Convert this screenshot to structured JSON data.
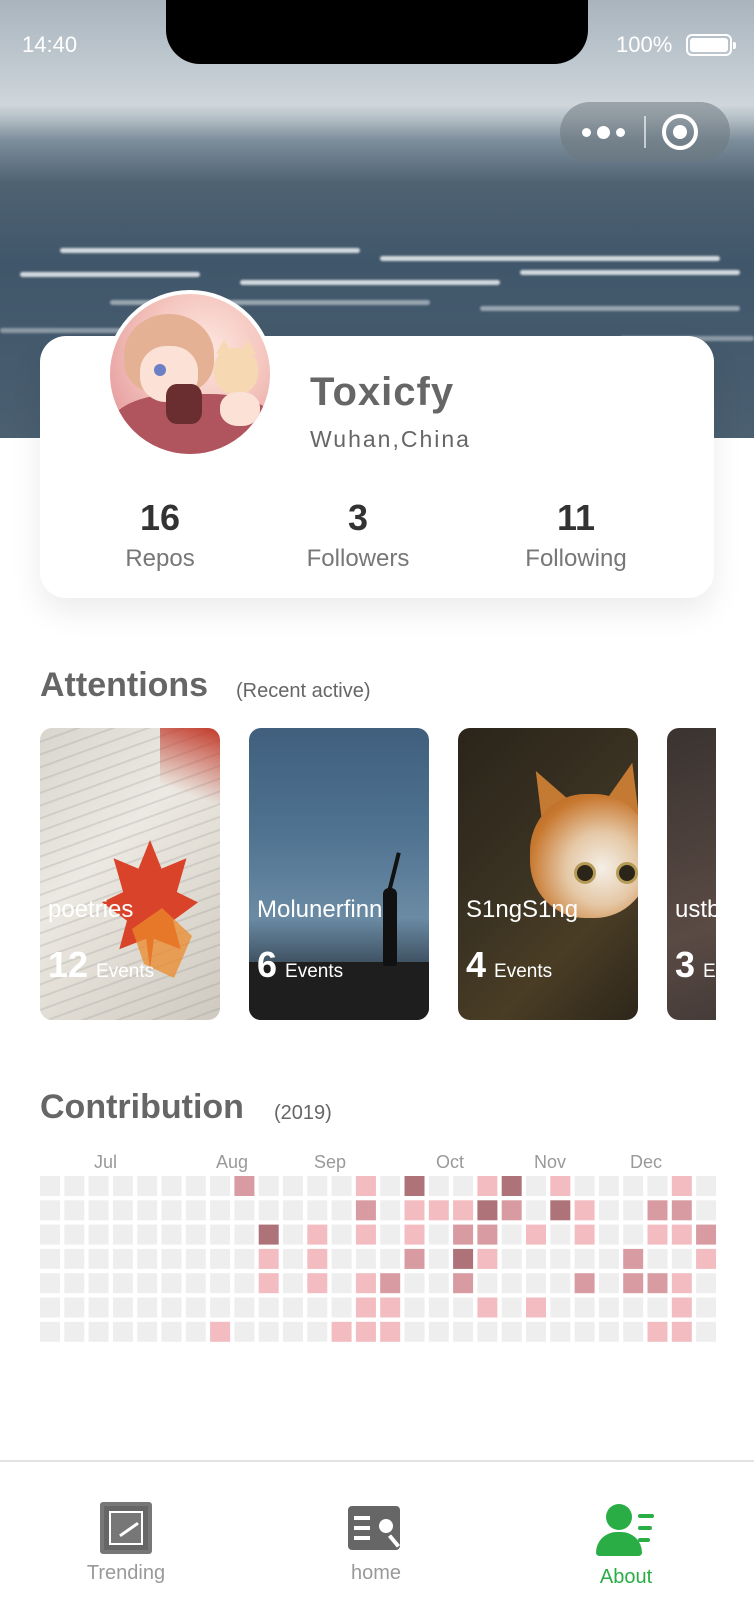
{
  "status_bar": {
    "time": "14:40",
    "battery": "100%"
  },
  "profile": {
    "name": "Toxicfy",
    "location": "Wuhan,China",
    "stats": [
      {
        "value": "16",
        "label": "Repos"
      },
      {
        "value": "3",
        "label": "Followers"
      },
      {
        "value": "11",
        "label": "Following"
      }
    ]
  },
  "attentions": {
    "title": "Attentions",
    "subtitle": "(Recent active)",
    "items": [
      {
        "name": "poetries",
        "count": "12",
        "unit": "Events"
      },
      {
        "name": "Molunerfinn",
        "count": "6",
        "unit": "Events"
      },
      {
        "name": "S1ngS1ng",
        "count": "4",
        "unit": "Events"
      },
      {
        "name": "ustb",
        "count": "3",
        "unit": "Events"
      }
    ]
  },
  "contribution": {
    "title": "Contribution",
    "subtitle": "(2019)",
    "months": [
      "Jul",
      "Aug",
      "Sep",
      "Oct",
      "Nov",
      "Dec"
    ],
    "colors": {
      "0": "#eeeeee",
      "1": "#f2bcc1",
      "2": "#d89ba1",
      "3": "#ad7378"
    },
    "weeks": [
      [
        0,
        0,
        0,
        0,
        0,
        0,
        0
      ],
      [
        0,
        0,
        0,
        0,
        0,
        0,
        0
      ],
      [
        0,
        0,
        0,
        0,
        0,
        0,
        0
      ],
      [
        0,
        0,
        0,
        0,
        0,
        0,
        0
      ],
      [
        0,
        0,
        0,
        0,
        0,
        0,
        0
      ],
      [
        0,
        0,
        0,
        0,
        0,
        0,
        0
      ],
      [
        0,
        0,
        0,
        0,
        0,
        0,
        0
      ],
      [
        0,
        0,
        0,
        0,
        0,
        0,
        1
      ],
      [
        2,
        0,
        0,
        0,
        0,
        0,
        0
      ],
      [
        0,
        0,
        3,
        1,
        1,
        0,
        0
      ],
      [
        0,
        0,
        0,
        0,
        0,
        0,
        0
      ],
      [
        0,
        0,
        1,
        1,
        1,
        0,
        0
      ],
      [
        0,
        0,
        0,
        0,
        0,
        0,
        1
      ],
      [
        1,
        2,
        1,
        0,
        1,
        1,
        1
      ],
      [
        0,
        0,
        0,
        0,
        2,
        1,
        1
      ],
      [
        3,
        1,
        1,
        2,
        0,
        0,
        0
      ],
      [
        0,
        1,
        0,
        0,
        0,
        0,
        0
      ],
      [
        0,
        1,
        2,
        3,
        2,
        0,
        0
      ],
      [
        1,
        3,
        2,
        1,
        0,
        1,
        0
      ],
      [
        3,
        2,
        0,
        0,
        0,
        0,
        0
      ],
      [
        0,
        0,
        1,
        0,
        0,
        1,
        0
      ],
      [
        1,
        3,
        0,
        0,
        0,
        0,
        0
      ],
      [
        0,
        1,
        1,
        0,
        2,
        0,
        0
      ],
      [
        0,
        0,
        0,
        0,
        0,
        0,
        0
      ],
      [
        0,
        0,
        0,
        2,
        2,
        0,
        0
      ],
      [
        0,
        2,
        1,
        0,
        2,
        0,
        1
      ],
      [
        1,
        2,
        1,
        0,
        1,
        1,
        1
      ],
      [
        0,
        0,
        2,
        1,
        0,
        0,
        0
      ],
      [
        1,
        0,
        0,
        0,
        1,
        1,
        0
      ]
    ]
  },
  "tabbar": {
    "items": [
      {
        "label": "Trending",
        "icon": "trending-icon"
      },
      {
        "label": "home",
        "icon": "book-search-icon"
      },
      {
        "label": "About",
        "icon": "user-list-icon"
      }
    ],
    "active_color": "#2aad45",
    "inactive_color": "#999999"
  }
}
